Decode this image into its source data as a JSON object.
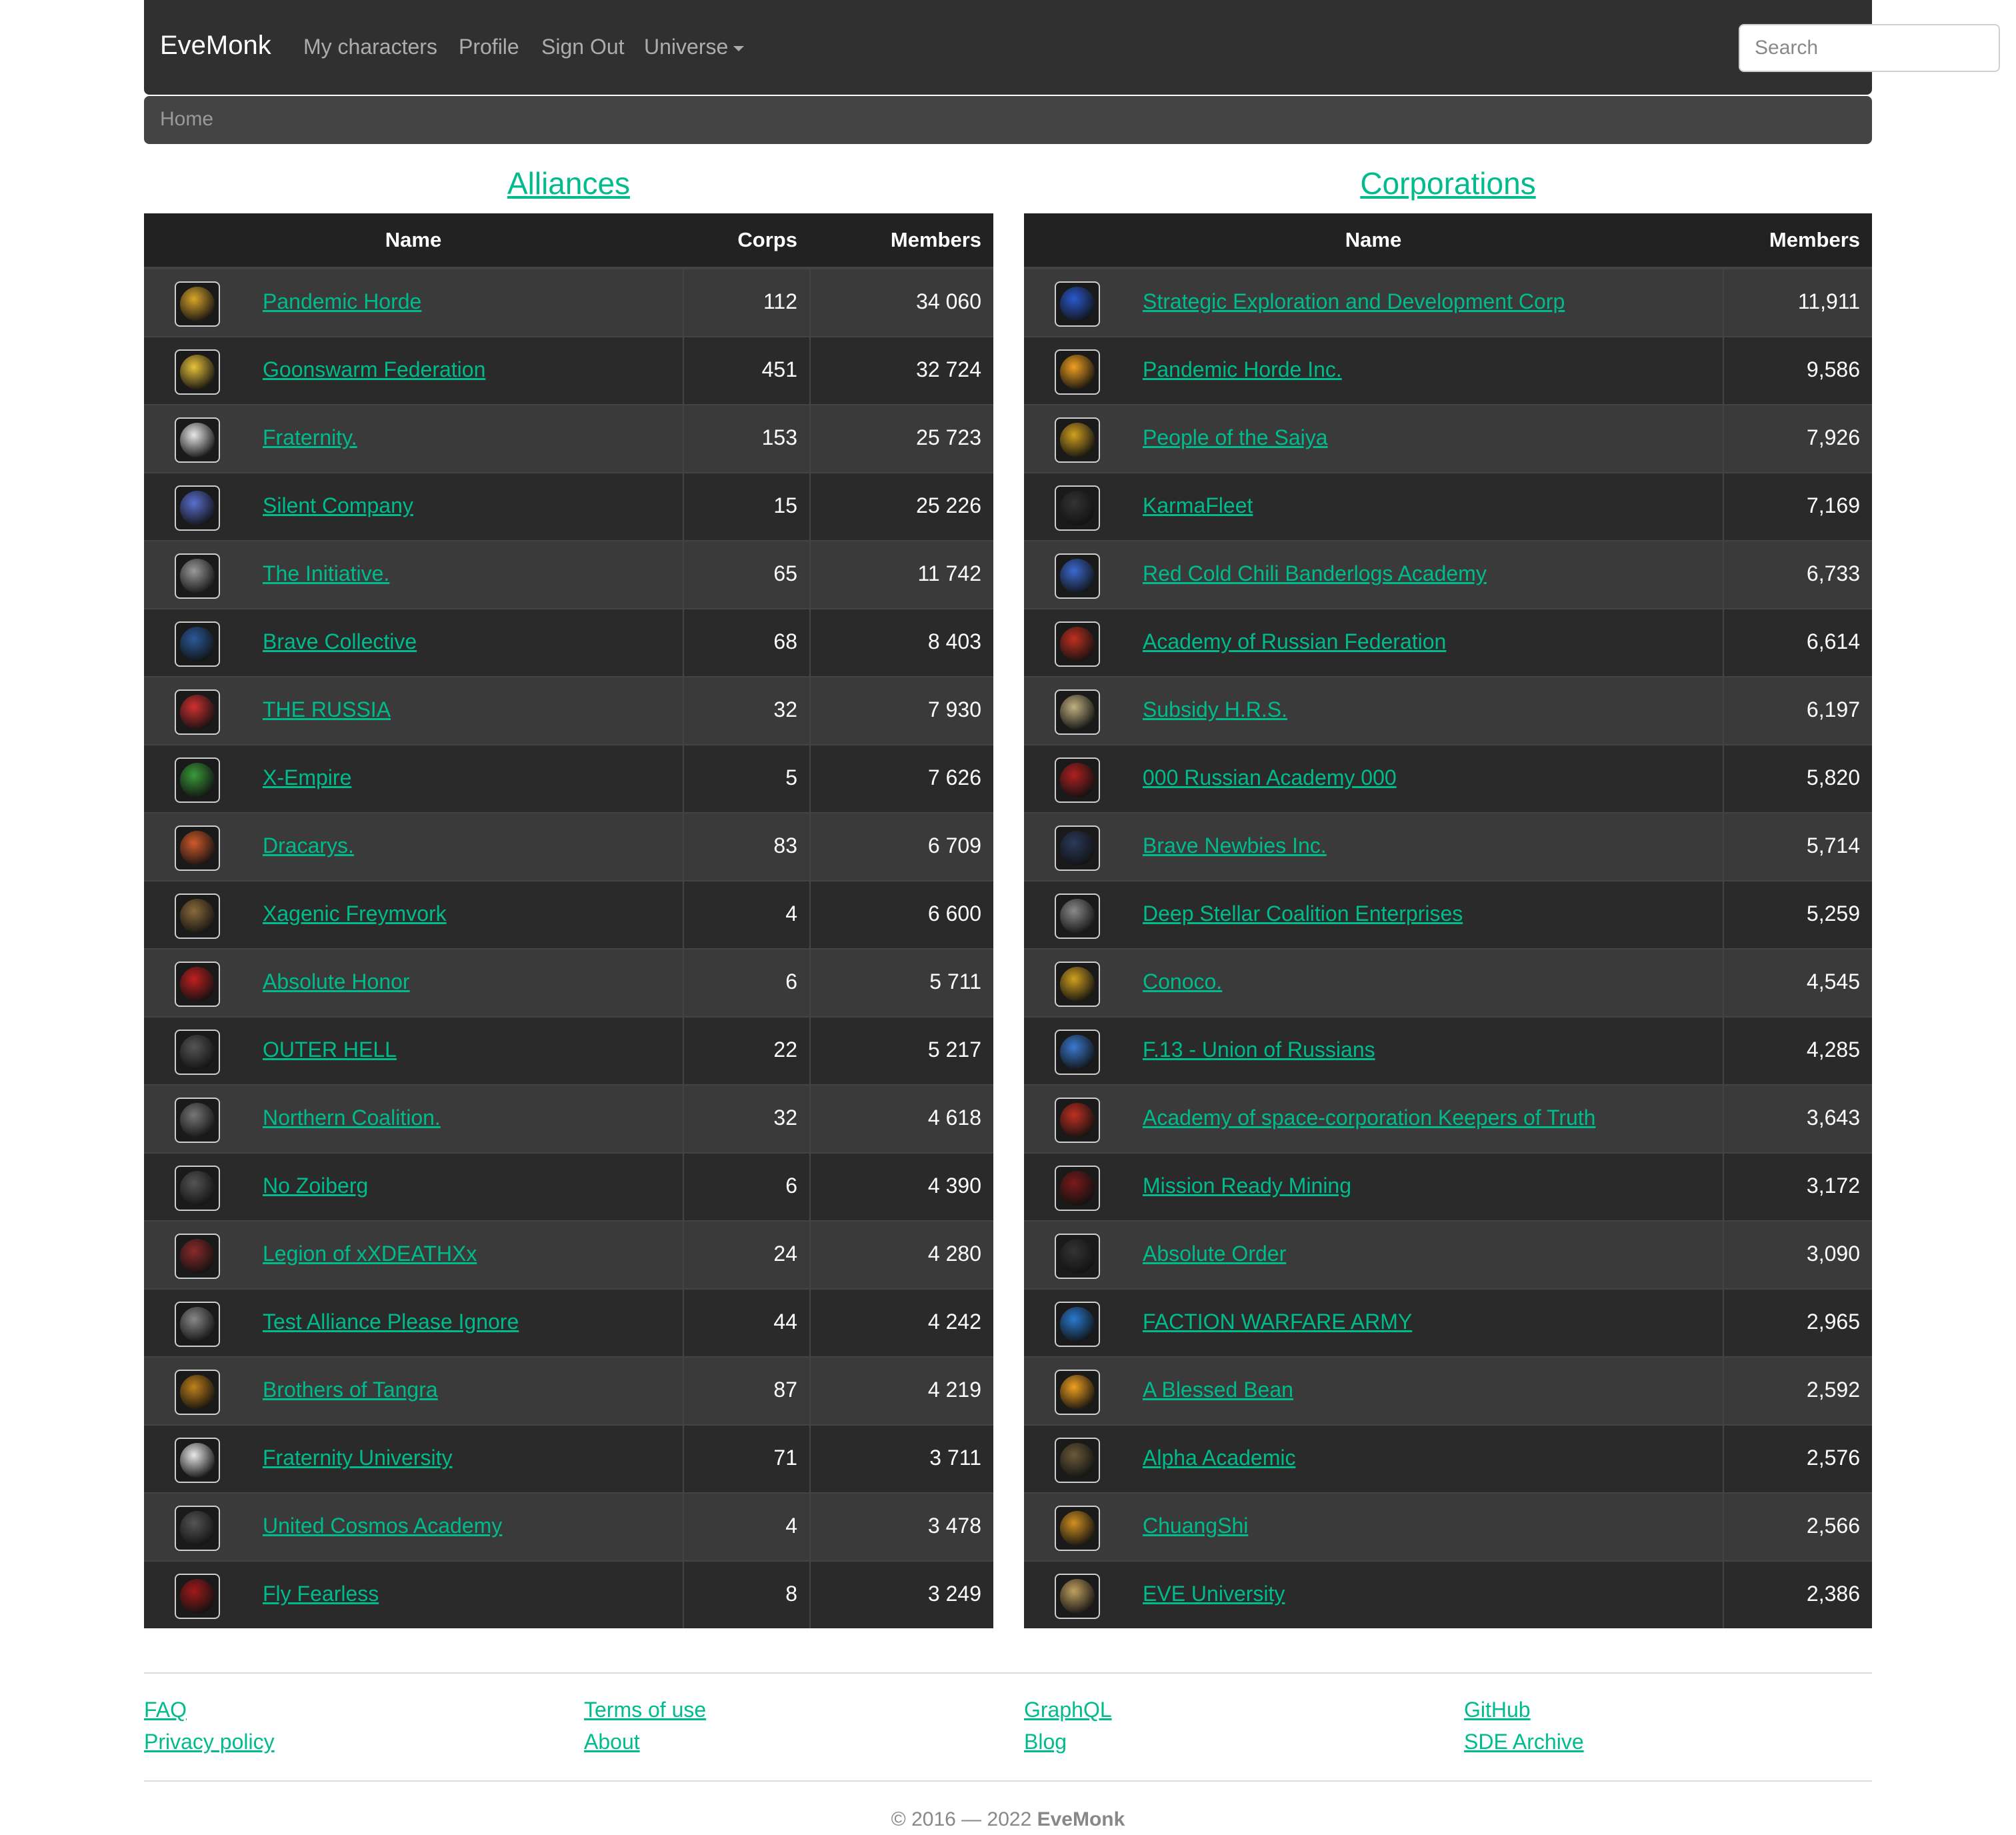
{
  "nav": {
    "brand": "EveMonk",
    "links": [
      "My characters",
      "Profile",
      "Sign Out",
      "Universe"
    ],
    "search_placeholder": "Search"
  },
  "breadcrumb": "Home",
  "alliances": {
    "title": "Alliances",
    "headers": {
      "name": "Name",
      "corps": "Corps",
      "members": "Members"
    },
    "rows": [
      {
        "name": "Pandemic Horde",
        "corps": "112",
        "members": "34 060",
        "logo_color": "#d9a52a"
      },
      {
        "name": "Goonswarm Federation",
        "corps": "451",
        "members": "32 724",
        "logo_color": "#e8c23a"
      },
      {
        "name": "Fraternity.",
        "corps": "153",
        "members": "25 723",
        "logo_color": "#e8e8e8"
      },
      {
        "name": "Silent Company",
        "corps": "15",
        "members": "25 226",
        "logo_color": "#5a6fd0"
      },
      {
        "name": "The Initiative.",
        "corps": "65",
        "members": "11 742",
        "logo_color": "#9a9a9a"
      },
      {
        "name": "Brave Collective",
        "corps": "68",
        "members": "8 403",
        "logo_color": "#2a5a9a"
      },
      {
        "name": "THE RUSSIA",
        "corps": "32",
        "members": "7 930",
        "logo_color": "#d03030"
      },
      {
        "name": "X-Empire",
        "corps": "5",
        "members": "7 626",
        "logo_color": "#3a9a3a"
      },
      {
        "name": "Dracarys.",
        "corps": "83",
        "members": "6 709",
        "logo_color": "#d05a2a"
      },
      {
        "name": "Xagenic Freymvork",
        "corps": "4",
        "members": "6 600",
        "logo_color": "#8a6a3a"
      },
      {
        "name": "Absolute Honor",
        "corps": "6",
        "members": "5 711",
        "logo_color": "#c02020"
      },
      {
        "name": "OUTER HELL",
        "corps": "22",
        "members": "5 217",
        "logo_color": "#555555"
      },
      {
        "name": "Northern Coalition.",
        "corps": "32",
        "members": "4 618",
        "logo_color": "#777777"
      },
      {
        "name": "No Zoiberg",
        "corps": "6",
        "members": "4 390",
        "logo_color": "#555555"
      },
      {
        "name": "Legion of xXDEATHXx",
        "corps": "24",
        "members": "4 280",
        "logo_color": "#8a2a2a"
      },
      {
        "name": "Test Alliance Please Ignore",
        "corps": "44",
        "members": "4 242",
        "logo_color": "#888888"
      },
      {
        "name": "Brothers of Tangra",
        "corps": "87",
        "members": "4 219",
        "logo_color": "#c0801a"
      },
      {
        "name": "Fraternity University",
        "corps": "71",
        "members": "3 711",
        "logo_color": "#e8e8e8"
      },
      {
        "name": "United Cosmos Academy",
        "corps": "4",
        "members": "3 478",
        "logo_color": "#555555"
      },
      {
        "name": "Fly Fearless",
        "corps": "8",
        "members": "3 249",
        "logo_color": "#a01a1a"
      }
    ]
  },
  "corporations": {
    "title": "Corporations",
    "headers": {
      "name": "Name",
      "members": "Members"
    },
    "rows": [
      {
        "name": "Strategic Exploration and Development Corp",
        "members": "11,911",
        "logo_color": "#2a5ad0"
      },
      {
        "name": "Pandemic Horde Inc.",
        "members": "9,586",
        "logo_color": "#f0a020"
      },
      {
        "name": "People of the Saiya",
        "members": "7,926",
        "logo_color": "#d0a020"
      },
      {
        "name": "KarmaFleet",
        "members": "7,169",
        "logo_color": "#333333"
      },
      {
        "name": "Red Cold Chili Banderlogs Academy",
        "members": "6,733",
        "logo_color": "#3a6ad0"
      },
      {
        "name": "Academy of Russian Federation",
        "members": "6,614",
        "logo_color": "#c03020"
      },
      {
        "name": "Subsidy H.R.S.",
        "members": "6,197",
        "logo_color": "#c0b080"
      },
      {
        "name": "000 Russian Academy 000",
        "members": "5,820",
        "logo_color": "#b02020"
      },
      {
        "name": "Brave Newbies Inc.",
        "members": "5,714",
        "logo_color": "#2a3a5a"
      },
      {
        "name": "Deep Stellar Coalition Enterprises",
        "members": "5,259",
        "logo_color": "#8a8a8a"
      },
      {
        "name": "Conoco.",
        "members": "4,545",
        "logo_color": "#d0a020"
      },
      {
        "name": "F.13 - Union of Russians",
        "members": "4,285",
        "logo_color": "#3a7ad0"
      },
      {
        "name": "Academy of space-corporation Keepers of Truth",
        "members": "3,643",
        "logo_color": "#c03020"
      },
      {
        "name": "Mission Ready Mining",
        "members": "3,172",
        "logo_color": "#7a1a1a"
      },
      {
        "name": "Absolute Order",
        "members": "3,090",
        "logo_color": "#333333"
      },
      {
        "name": "FACTION WARFARE ARMY",
        "members": "2,965",
        "logo_color": "#2a7ad0"
      },
      {
        "name": "A Blessed Bean",
        "members": "2,592",
        "logo_color": "#f0a020"
      },
      {
        "name": "Alpha Academic",
        "members": "2,576",
        "logo_color": "#6a5a3a"
      },
      {
        "name": "ChuangShi",
        "members": "2,566",
        "logo_color": "#d09020"
      },
      {
        "name": "EVE University",
        "members": "2,386",
        "logo_color": "#c0a060"
      }
    ]
  },
  "footer": {
    "col1": [
      "FAQ",
      "Privacy policy"
    ],
    "col2": [
      "Terms of use",
      "About"
    ],
    "col3": [
      "GraphQL",
      "Blog"
    ],
    "col4": [
      "GitHub",
      "SDE Archive"
    ],
    "copyright_prefix": "© 2016 — 2022",
    "copyright_brand": "EveMonk"
  }
}
